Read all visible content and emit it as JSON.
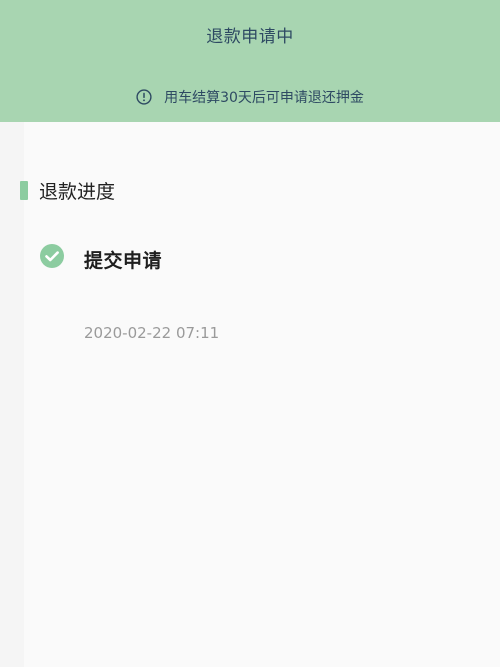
{
  "header": {
    "title": "退款申请中",
    "notice": "用车结算30天后可申请退还押金",
    "notice_icon": "info-icon",
    "background_color": "#a8d5b1"
  },
  "progress": {
    "section_title": "退款进度",
    "accent_color": "#8ccca0",
    "steps": [
      {
        "title": "提交申请",
        "time": "2020-02-22 07:11",
        "status_icon": "check-circle-icon",
        "completed": true
      }
    ]
  }
}
